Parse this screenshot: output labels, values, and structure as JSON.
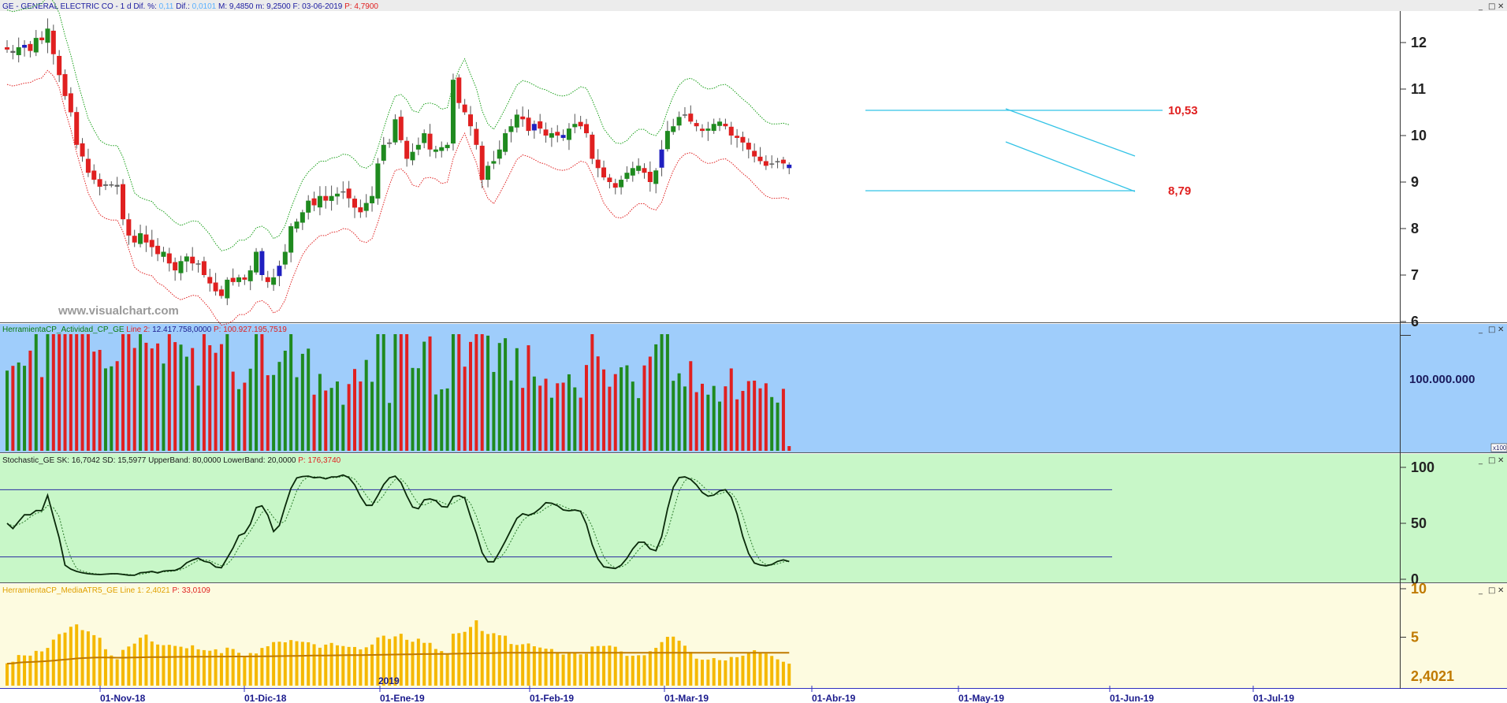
{
  "watermark": "www.visualchart.com",
  "window_buttons": [
    "_",
    "□",
    "✕"
  ],
  "colors": {
    "up": "#1f8a1f",
    "down": "#e02020",
    "neutral": "#2020c0",
    "upper_band": "#1aa01a",
    "lower_band": "#e02020",
    "channel": "#33c3e6",
    "vol_bg": "#9fcdfb",
    "stoch_bg": "#c8f7c8",
    "atr_bg": "#fdfbe0",
    "atr_bar": "#f5b800",
    "atr_line": "#c07a00"
  },
  "panels": {
    "price": {
      "header": [
        {
          "text": "GE - GENERAL ELECTRIC CO -  1 d  Dif. %: ",
          "color": "#1a1aa0"
        },
        {
          "text": "0,11",
          "color": "#5ab0ff"
        },
        {
          "text": "  Dif.: ",
          "color": "#1a1aa0"
        },
        {
          "text": "0,0101",
          "color": "#5ab0ff"
        },
        {
          "text": "  M: 9,4850  m: 9,2500  F: 03-06-2019  ",
          "color": "#1a1aa0"
        },
        {
          "text": "P: 4,7900",
          "color": "#e02020"
        }
      ],
      "y_ticks": [
        "12",
        "11",
        "10",
        "9",
        "8",
        "7",
        "6"
      ],
      "annotations": [
        "10,53",
        "8,79"
      ]
    },
    "volume": {
      "header": [
        {
          "text": "HerramientaCP_Actividad_CP_GE  ",
          "color": "#0b7a0b"
        },
        {
          "text": "Line 2: ",
          "color": "#e02020"
        },
        {
          "text": "12.417.758,0000  ",
          "color": "#1a1a8c"
        },
        {
          "text": "P: 100.927.195,7519",
          "color": "#e02020"
        }
      ],
      "y_label": "100.000.000",
      "scale_tag": "x100"
    },
    "stochastic": {
      "header": [
        {
          "text": "Stochastic_GE  SK: 16,7042  SD: 15,5977  UpperBand: 80,0000  LowerBand: 20,0000  ",
          "color": "#1a1a1a"
        },
        {
          "text": "P: 176,3740",
          "color": "#e02020"
        }
      ],
      "y_ticks": [
        "100",
        "50",
        "0"
      ]
    },
    "atr": {
      "header": [
        {
          "text": "HerramientaCP_MediaATR5_GE  Line 1: 2,4021  ",
          "color": "#e0a000"
        },
        {
          "text": "P: 33,0109",
          "color": "#e02020"
        }
      ],
      "y_ticks": [
        "10",
        "5"
      ],
      "last_value": "2,4021"
    }
  },
  "x_axis": {
    "labels": [
      "01-Nov-18",
      "01-Dic-18",
      "01-Ene-19",
      "01-Feb-19",
      "01-Mar-19",
      "01-Abr-19",
      "01-May-19",
      "01-Jun-19",
      "01-Jul-19"
    ],
    "year_label": "2019"
  },
  "chart_data": {
    "type": "candlestick",
    "title": "GE - GENERAL ELECTRIC CO - 1 d",
    "date_range": [
      "01-Oct-18",
      "03-Jun-19"
    ],
    "price_ylim": [
      6,
      12.7
    ],
    "close": [
      11.85,
      11.78,
      11.9,
      11.95,
      11.82,
      12.1,
      12.05,
      12.3,
      11.75,
      11.3,
      10.85,
      10.5,
      9.8,
      9.55,
      9.2,
      9.05,
      8.9,
      8.95,
      8.95,
      8.9,
      8.2,
      7.85,
      7.7,
      7.9,
      7.7,
      7.6,
      7.45,
      7.5,
      7.25,
      7.1,
      7.3,
      7.4,
      7.25,
      7.25,
      7.0,
      6.82,
      6.65,
      6.55,
      6.9,
      6.85,
      6.95,
      6.9,
      7.1,
      7.5,
      7.0,
      6.85,
      6.95,
      7.2,
      7.5,
      8.05,
      8.15,
      8.35,
      8.6,
      8.5,
      8.7,
      8.6,
      8.7,
      8.75,
      8.8,
      8.65,
      8.45,
      8.35,
      8.55,
      8.7,
      9.4,
      9.8,
      9.85,
      10.35,
      9.9,
      9.5,
      9.65,
      9.8,
      10.05,
      9.7,
      9.7,
      9.75,
      9.8,
      11.2,
      10.7,
      10.5,
      10.2,
      9.8,
      9.05,
      9.35,
      9.45,
      9.7,
      10.05,
      10.2,
      10.45,
      10.35,
      10.1,
      10.25,
      10.15,
      10.0,
      10.05,
      10.0,
      9.95,
      10.15,
      10.25,
      10.2,
      10.05,
      9.5,
      9.3,
      9.1,
      9.0,
      8.88,
      9.05,
      9.2,
      9.3,
      9.35,
      9.2,
      9.0,
      9.25,
      9.7,
      10.1,
      10.2,
      10.4,
      10.45,
      10.3,
      10.2,
      10.1,
      10.15,
      10.25,
      10.3,
      10.2,
      10.0,
      9.95,
      9.85,
      9.7,
      9.55,
      9.45,
      9.35,
      9.4,
      9.45,
      9.4,
      9.3
    ],
    "trading_days": 139,
    "indicators": {
      "volume": {
        "type": "bar",
        "last_value": 12417758,
        "y_label": "100.000.000"
      },
      "stochastic": {
        "type": "line",
        "SK": 16.7042,
        "SD": 15.5977,
        "upper_band": 80,
        "lower_band": 20,
        "ylim": [
          0,
          100
        ]
      },
      "atr5": {
        "type": "bar",
        "last_value": 2.4021,
        "ylim": [
          0,
          10.5
        ]
      }
    },
    "horizontal_levels": [
      10.53,
      8.79
    ]
  }
}
